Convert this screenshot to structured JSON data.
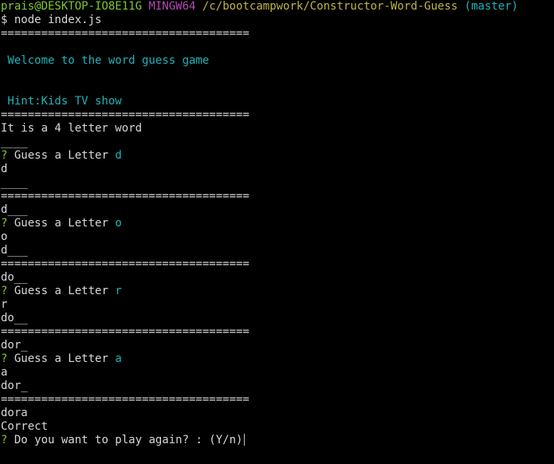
{
  "colors": {
    "background": "#000000",
    "text": "#d7d7d7",
    "prompt_user": "#7ec832",
    "prompt_shell": "#b44bb4",
    "prompt_path": "#c0b448",
    "prompt_branch": "#1fb3b8",
    "question_mark": "#7ec832",
    "answer": "#1fb3b8"
  },
  "prompt": {
    "user_host": "prais@DESKTOP-IO8E11G",
    "shell": "MINGW64",
    "path": "/c/bootcampwork/Constructor-Word-Guess",
    "branch": "(master)",
    "command_line": "$ node index.js"
  },
  "game": {
    "separator": "=====================================",
    "welcome": " Welcome to the word guess game",
    "hint": " Hint:Kids TV show",
    "intro": "It is a 4 letter word",
    "blank_word": "____",
    "question_mark": "?",
    "guess_label": "Guess a Letter",
    "rounds": [
      {
        "before": "____",
        "letter": "d",
        "echo": "d",
        "after": "____",
        "result": "d___"
      },
      {
        "before": "d___",
        "letter": "o",
        "echo": "o",
        "after": "d___",
        "result": "do__"
      },
      {
        "before": "do__",
        "letter": "r",
        "echo": "r",
        "after": "do__",
        "result": "dor_"
      },
      {
        "before": "dor_",
        "letter": "a",
        "echo": "a",
        "after": "dor_",
        "result": "dora"
      }
    ],
    "correct": "Correct",
    "play_again": "Do you want to play again? : (Y/n)"
  }
}
